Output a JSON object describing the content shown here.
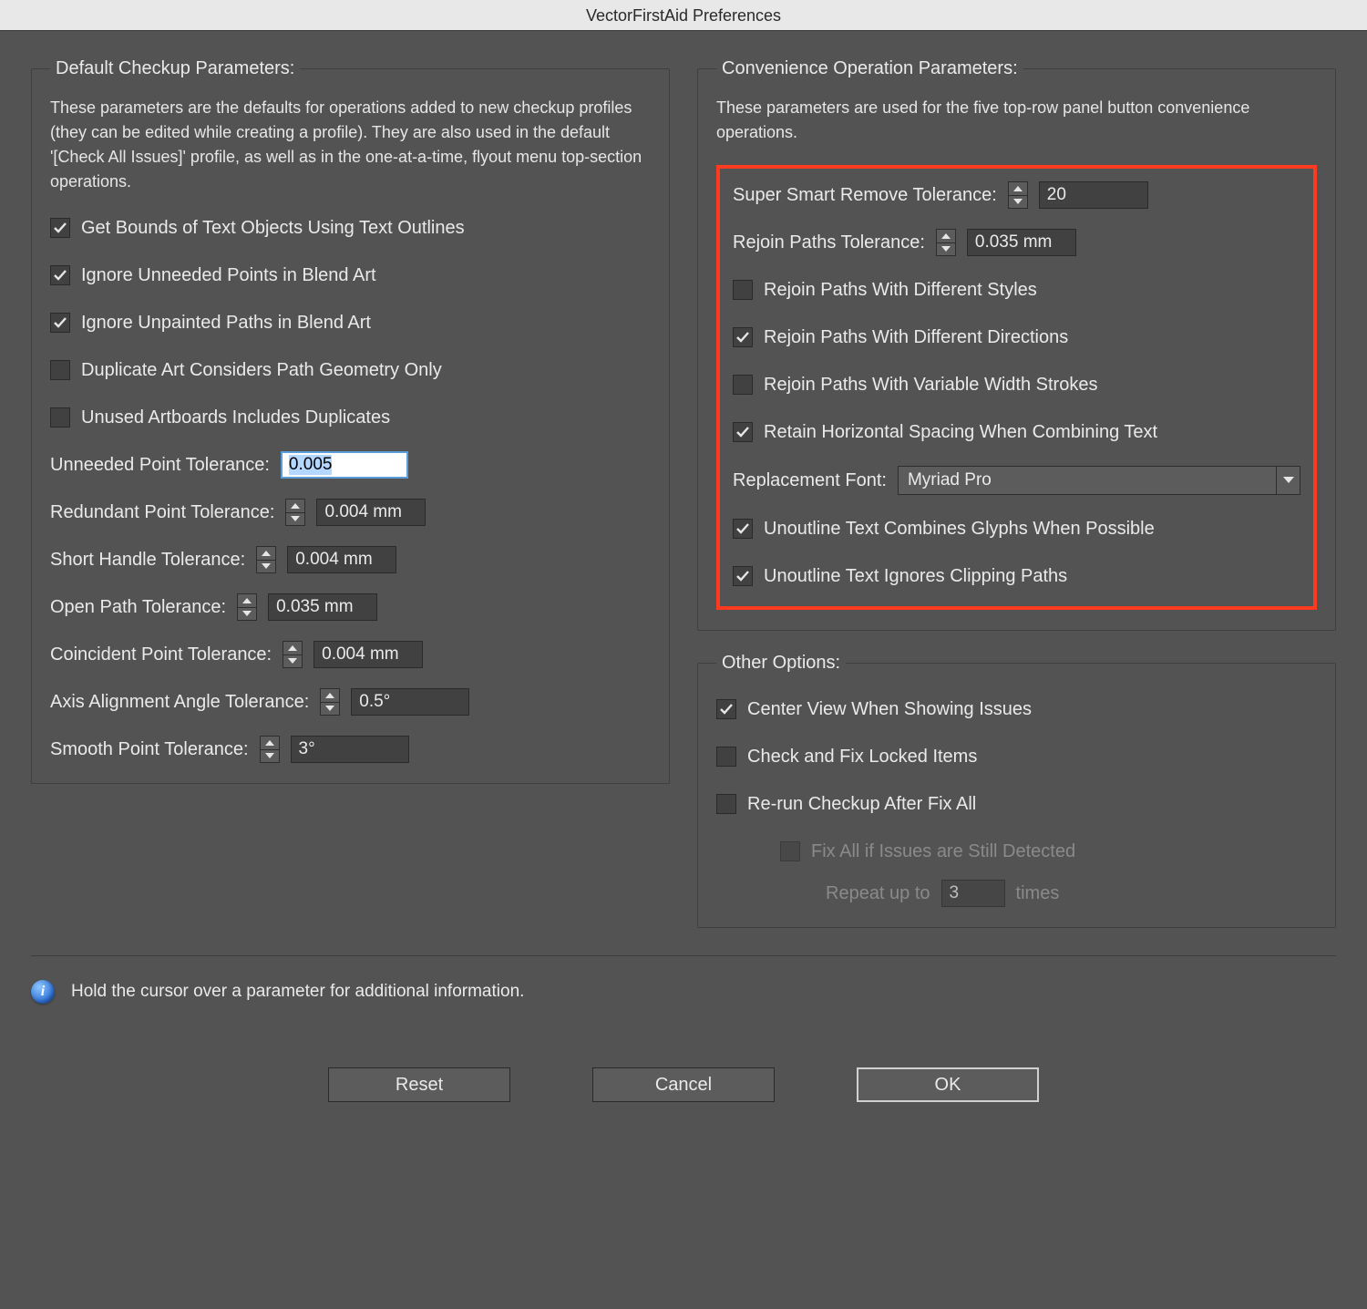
{
  "window": {
    "title": "VectorFirstAid Preferences"
  },
  "left": {
    "legend": "Default Checkup Parameters:",
    "desc": "These parameters are the defaults for operations added to new checkup profiles (they can be edited while creating a profile). They are also used in the default '[Check All Issues]' profile, as well as in the one-at-a-time, flyout menu top-section operations.",
    "cb_bounds": "Get Bounds of Text Objects Using Text Outlines",
    "cb_ignore_points": "Ignore Unneeded Points in Blend Art",
    "cb_ignore_unpainted": "Ignore Unpainted Paths in Blend Art",
    "cb_dup_geom": "Duplicate Art Considers Path Geometry Only",
    "cb_unused_artboards": "Unused Artboards Includes Duplicates",
    "unneeded_label": "Unneeded Point Tolerance:",
    "unneeded_val": "0.005",
    "redundant_label": "Redundant Point Tolerance:",
    "redundant_val": "0.004 mm",
    "shorthandle_label": "Short Handle Tolerance:",
    "shorthandle_val": "0.004 mm",
    "openpath_label": "Open Path Tolerance:",
    "openpath_val": "0.035 mm",
    "coincident_label": "Coincident Point Tolerance:",
    "coincident_val": "0.004 mm",
    "axis_label": "Axis Alignment Angle Tolerance:",
    "axis_val": "0.5°",
    "smooth_label": "Smooth Point Tolerance:",
    "smooth_val": "3°"
  },
  "right_conv": {
    "legend": "Convenience Operation Parameters:",
    "desc": "These parameters are used for the five top-row panel button convenience operations.",
    "ssr_label": "Super Smart Remove Tolerance:",
    "ssr_val": "20",
    "rejoin_label": "Rejoin Paths Tolerance:",
    "rejoin_val": "0.035 mm",
    "cb_diff_styles": "Rejoin Paths With Different Styles",
    "cb_diff_dirs": "Rejoin Paths With Different Directions",
    "cb_var_width": "Rejoin Paths With Variable Width Strokes",
    "cb_retain_spacing": "Retain Horizontal Spacing When Combining Text",
    "font_label": "Replacement Font:",
    "font_val": "Myriad Pro",
    "cb_unoutline_combine": "Unoutline Text Combines Glyphs When Possible",
    "cb_unoutline_clip": "Unoutline Text Ignores Clipping Paths"
  },
  "right_other": {
    "legend": "Other Options:",
    "cb_center": "Center View When Showing Issues",
    "cb_locked": "Check and Fix Locked Items",
    "cb_rerun": "Re-run Checkup After Fix All",
    "cb_fixall": "Fix All if Issues are Still Detected",
    "repeat_label": "Repeat up to",
    "repeat_val": "3",
    "repeat_suffix": "times"
  },
  "info": "Hold the cursor over a parameter for additional information.",
  "buttons": {
    "reset": "Reset",
    "cancel": "Cancel",
    "ok": "OK"
  }
}
